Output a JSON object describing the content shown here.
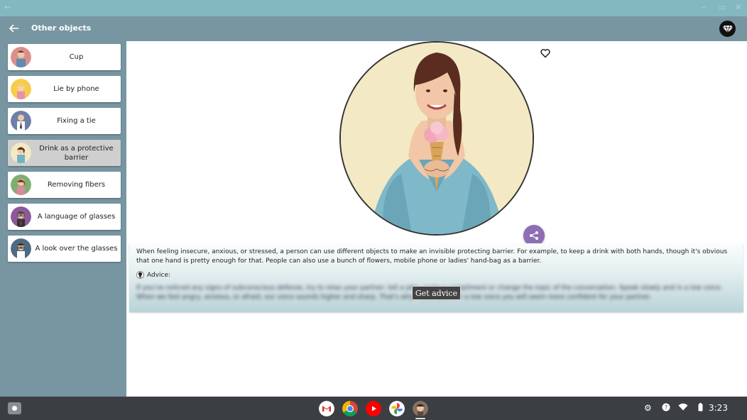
{
  "appbar": {
    "title": "Other objects"
  },
  "sidebar": {
    "items": [
      {
        "label": "Cup"
      },
      {
        "label": "Lie by phone"
      },
      {
        "label": "Fixing a tie"
      },
      {
        "label": "Drink as a protective barrier"
      },
      {
        "label": "Removing fibers"
      },
      {
        "label": "A language of glasses"
      },
      {
        "label": "A look over the glasses"
      }
    ],
    "selected_index": 3
  },
  "content": {
    "description": "When feeling insecure, anxious, or stressed, a person can use different objects to make an invisible protecting barrier. For example, to keep a drink with both hands, though it's obvious that one hand is pretty enough for that. People can also use a bunch of flowers, mobile phone or ladies' hand-bag as a barrier.",
    "advice_label": "Advice:",
    "hidden_advice": "If you've noticed any signs of subconscious defense, try to relax your partner: tell a joke, make a compliment or change the topic of the conversation. Speak slowly and in a low voice. When we feel angry, anxious, or afraid, our voice sounds higher and sharp. That's why if you speak in a low voice you will seem more confident for your partner.",
    "get_advice_button": "Get advice"
  },
  "taskbar": {
    "clock": "3:23"
  },
  "colors": {
    "appbar": "#7896a2",
    "titlebar": "#83b8c1",
    "share": "#8d6fb5",
    "taskbar": "#3b3f44"
  }
}
